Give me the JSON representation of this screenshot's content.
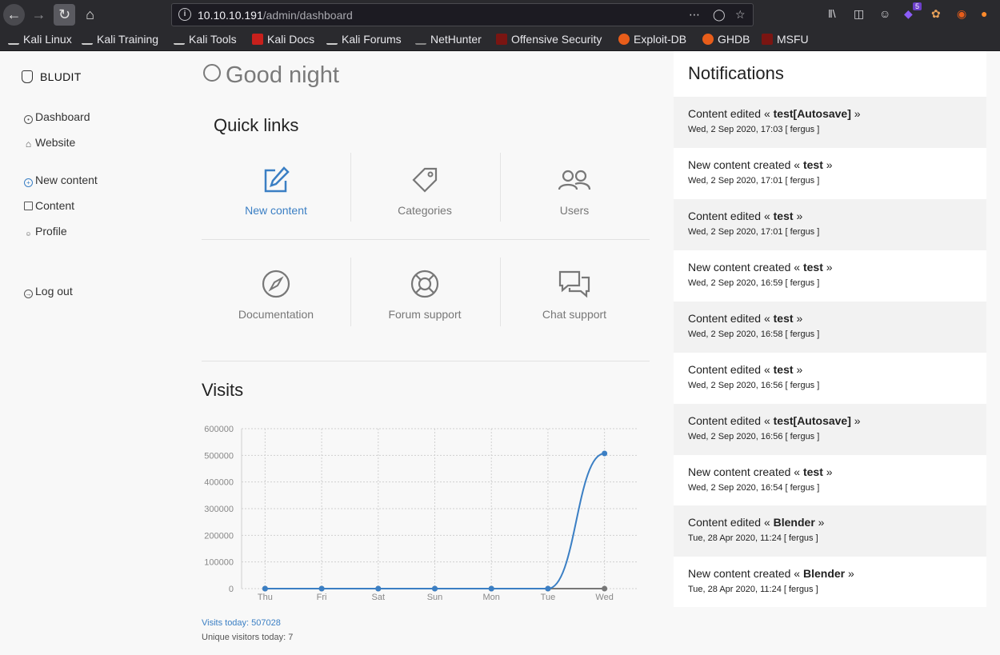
{
  "browser": {
    "url_host": "10.10.10.191",
    "url_path": "/admin/dashboard",
    "extension_badge": "5"
  },
  "bookmarks": [
    {
      "label": "Kali Linux",
      "color": "#e8e8ec"
    },
    {
      "label": "Kali Training",
      "color": "#e8e8ec"
    },
    {
      "label": "Kali Tools",
      "color": "#e8e8ec"
    },
    {
      "label": "Kali Docs",
      "color": "#c8201c"
    },
    {
      "label": "Kali Forums",
      "color": "#e8e8ec"
    },
    {
      "label": "NetHunter",
      "color": "#e8e8ec"
    },
    {
      "label": "Offensive Security",
      "color": "#c8201c"
    },
    {
      "label": "Exploit-DB",
      "color": "#e85d1a"
    },
    {
      "label": "GHDB",
      "color": "#e85d1a"
    },
    {
      "label": "MSFU",
      "color": "#c8201c"
    }
  ],
  "sidebar": {
    "brand": "BLUDIT",
    "items": [
      {
        "label": "Dashboard",
        "icon": "dashboard-icon"
      },
      {
        "label": "Website",
        "icon": "home-icon"
      },
      {
        "label": "New content",
        "icon": "plus-circle-icon"
      },
      {
        "label": "Content",
        "icon": "archive-icon"
      },
      {
        "label": "Profile",
        "icon": "user-icon"
      },
      {
        "label": "Log out",
        "icon": "logout-icon"
      }
    ]
  },
  "main": {
    "greeting": "Good night",
    "quick_links_title": "Quick links",
    "quick_links": [
      {
        "label": "New content",
        "icon": "edit-icon"
      },
      {
        "label": "Categories",
        "icon": "tag-icon"
      },
      {
        "label": "Users",
        "icon": "users-icon"
      },
      {
        "label": "Documentation",
        "icon": "compass-icon"
      },
      {
        "label": "Forum support",
        "icon": "lifebuoy-icon"
      },
      {
        "label": "Chat support",
        "icon": "chat-icon"
      }
    ],
    "visits_title": "Visits",
    "visits_today": "Visits today: 507028",
    "unique_today": "Unique visitors today: 7"
  },
  "chart_data": {
    "type": "line",
    "categories": [
      "Thu",
      "Fri",
      "Sat",
      "Sun",
      "Mon",
      "Tue",
      "Wed"
    ],
    "series": [
      {
        "values": [
          0,
          0,
          0,
          0,
          0,
          0,
          507028
        ],
        "color": "#3b7fc4"
      },
      {
        "values": [
          0,
          0,
          0,
          0,
          0,
          0,
          7
        ],
        "color": "#777777"
      }
    ],
    "y_ticks": [
      "600000",
      "500000",
      "400000",
      "300000",
      "200000",
      "100000",
      "0"
    ],
    "ylim": [
      0,
      600000
    ],
    "grid": true
  },
  "notifications": {
    "title": "Notifications",
    "items": [
      {
        "prefix": "Content edited «",
        "target": "test[Autosave]",
        "suffix": "»",
        "meta": "Wed, 2 Sep 2020, 17:03 [ fergus ]"
      },
      {
        "prefix": "New content created «",
        "target": "test",
        "suffix": "»",
        "meta": "Wed, 2 Sep 2020, 17:01 [ fergus ]"
      },
      {
        "prefix": "Content edited «",
        "target": "test",
        "suffix": "»",
        "meta": "Wed, 2 Sep 2020, 17:01 [ fergus ]"
      },
      {
        "prefix": "New content created «",
        "target": "test",
        "suffix": "»",
        "meta": "Wed, 2 Sep 2020, 16:59 [ fergus ]"
      },
      {
        "prefix": "Content edited «",
        "target": "test",
        "suffix": "»",
        "meta": "Wed, 2 Sep 2020, 16:58 [ fergus ]"
      },
      {
        "prefix": "Content edited «",
        "target": "test",
        "suffix": "»",
        "meta": "Wed, 2 Sep 2020, 16:56 [ fergus ]"
      },
      {
        "prefix": "Content edited «",
        "target": "test[Autosave]",
        "suffix": "»",
        "meta": "Wed, 2 Sep 2020, 16:56 [ fergus ]"
      },
      {
        "prefix": "New content created «",
        "target": "test",
        "suffix": "»",
        "meta": "Wed, 2 Sep 2020, 16:54 [ fergus ]"
      },
      {
        "prefix": "Content edited «",
        "target": "Blender",
        "suffix": "»",
        "meta": "Tue, 28 Apr 2020, 11:24 [ fergus ]"
      },
      {
        "prefix": "New content created «",
        "target": "Blender",
        "suffix": "»",
        "meta": "Tue, 28 Apr 2020, 11:24 [ fergus ]"
      }
    ]
  }
}
